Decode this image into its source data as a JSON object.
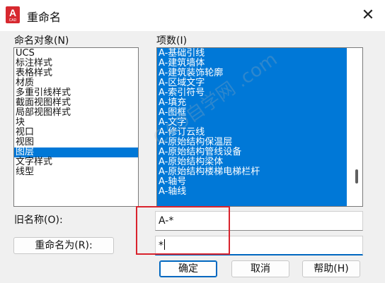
{
  "window": {
    "title": "重命名",
    "app_icon_letter": "A",
    "app_icon_caption": "CAD",
    "close_glyph": "✕"
  },
  "named_objects": {
    "label": "命名对象(N)",
    "items": [
      "UCS",
      "标注样式",
      "表格样式",
      "材质",
      "多重引线样式",
      "截面视图样式",
      "局部视图样式",
      "块",
      "视口",
      "视图",
      "图层",
      "文字样式",
      "线型"
    ],
    "selected": "图层"
  },
  "items": {
    "label": "项数(I)",
    "values": [
      "A-基础引线",
      "A-建筑墙体",
      "A-建筑装饰轮廓",
      "A-区域文字",
      "A-索引符号",
      "A-填充",
      "A-图框",
      "A-文字",
      "A-修订云线",
      "A-原始结构保温层",
      "A-原始结构管线设备",
      "A-原始结构梁体",
      "A-原始结构楼梯电梯栏杆",
      "A-轴号",
      "A-轴线"
    ]
  },
  "old_name": {
    "label": "旧名称(O):",
    "value": "A-*"
  },
  "rename_to": {
    "button_label": "重命名为(R):",
    "value": "*"
  },
  "buttons": {
    "ok": "确定",
    "cancel": "取消",
    "help": "帮助(H)"
  },
  "watermark": "CAD自学网 .com",
  "colors": {
    "selection": "#0078d7",
    "annotation_box": "#d9232d",
    "app_icon": "#d7282f"
  }
}
